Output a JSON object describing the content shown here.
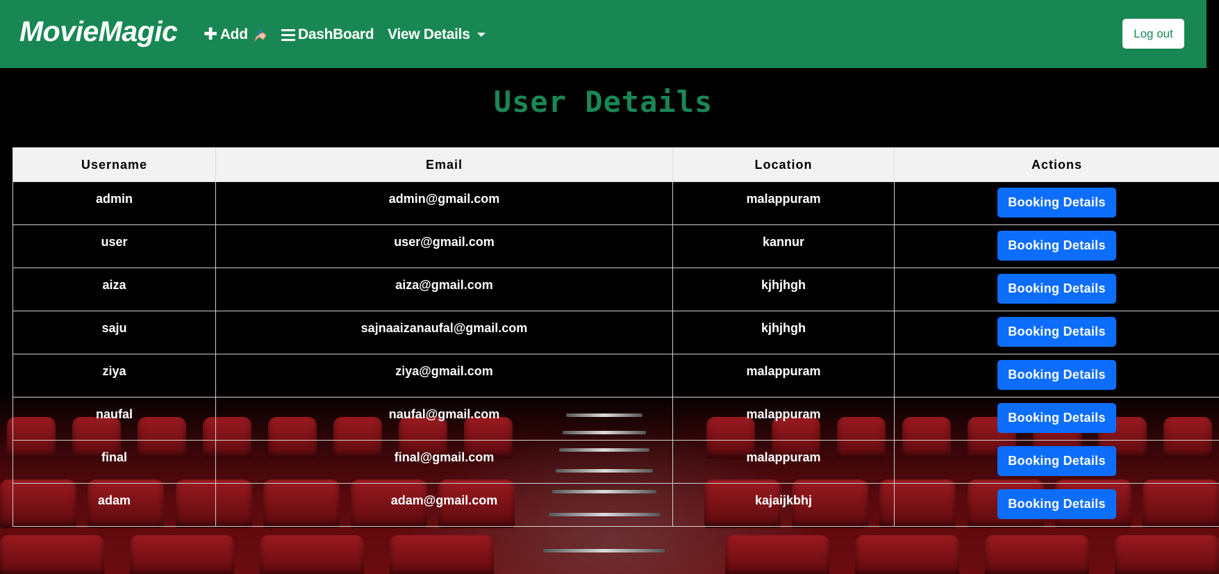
{
  "navbar": {
    "brand": "MovieMagic",
    "add_label": "Add",
    "dashboard_label": "DashBoard",
    "view_details_label": "View Details",
    "logout_label": "Log out",
    "color": "#198754"
  },
  "page": {
    "title": "User Details"
  },
  "table": {
    "headers": [
      "Username",
      "Email",
      "Location",
      "Actions"
    ],
    "action_label": "Booking Details",
    "rows": [
      {
        "username": "admin",
        "email": "admin@gmail.com",
        "location": "malappuram"
      },
      {
        "username": "user",
        "email": "user@gmail.com",
        "location": "kannur"
      },
      {
        "username": "aiza",
        "email": "aiza@gmail.com",
        "location": "kjhjhgh"
      },
      {
        "username": "saju",
        "email": "sajnaaizanaufal@gmail.com",
        "location": "kjhjhgh"
      },
      {
        "username": "ziya",
        "email": "ziya@gmail.com",
        "location": "malappuram"
      },
      {
        "username": "naufal",
        "email": "naufal@gmail.com",
        "location": "malappuram"
      },
      {
        "username": "final",
        "email": "final@gmail.com",
        "location": "malappuram"
      },
      {
        "username": "adam",
        "email": "adam@gmail.com",
        "location": "kajaijkbhj"
      }
    ]
  },
  "colors": {
    "accent": "#198754",
    "button": "#0d6efd",
    "header_bg": "#f2f2f2"
  }
}
